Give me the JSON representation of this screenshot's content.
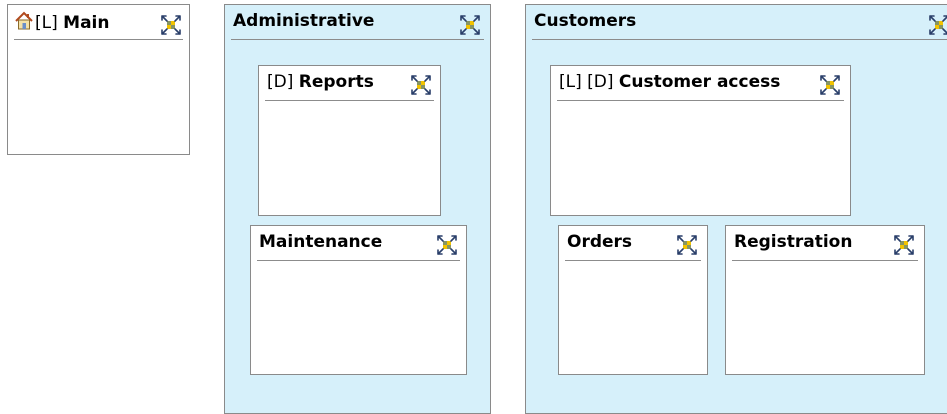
{
  "nodes": {
    "main": {
      "tag": "[L]",
      "name": "Main",
      "icon": "home-icon"
    },
    "administrative": {
      "name": "Administrative"
    },
    "reports": {
      "tag": "[D]",
      "name": "Reports"
    },
    "maintenance": {
      "name": "Maintenance"
    },
    "customers": {
      "name": "Customers"
    },
    "customer_access": {
      "tag": "[L] [D]",
      "name": "Customer access"
    },
    "orders": {
      "name": "Orders"
    },
    "registration": {
      "name": "Registration"
    }
  },
  "icons": {
    "node_action": "move-arrows-icon"
  },
  "colors": {
    "group_fill": "#d6f0fa",
    "node_fill": "#ffffff",
    "border": "#8a8a8a",
    "icon_yellow": "#f2c300",
    "icon_blue": "#2f6fb5"
  }
}
